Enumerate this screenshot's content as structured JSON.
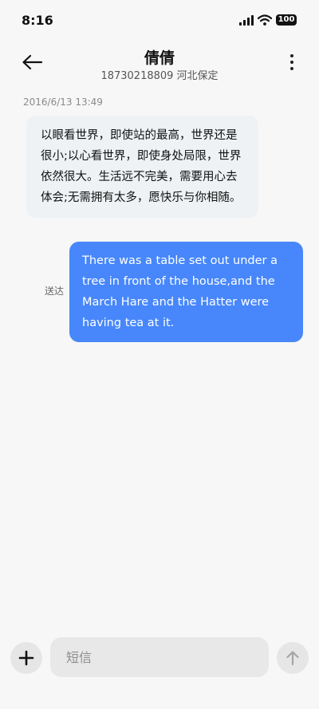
{
  "status_bar": {
    "time": "8:16",
    "battery": "100",
    "icons": [
      "signal-icon",
      "wifi-icon",
      "battery-icon"
    ]
  },
  "header": {
    "back_icon": "arrow-left-icon",
    "contact_name": "倩倩",
    "contact_subtitle": "18730218809 河北保定",
    "more_icon": "more-vertical-icon"
  },
  "conversation": {
    "timestamp": "2016/6/13 13:49",
    "messages": [
      {
        "direction": "incoming",
        "text": "以眼看世界，即使站的最高，世界还是很小;以心看世界，即使身处局限，世界依然很大。生活远不完美，需要用心去体会;无需拥有太多，愿快乐与你相随。"
      },
      {
        "direction": "outgoing",
        "text": "There was a table set out under a tree in front of the house,and the March Hare and the Hatter were having tea at it.",
        "status": "送达"
      }
    ]
  },
  "composer": {
    "add_icon": "plus-icon",
    "placeholder": "短信",
    "value": "",
    "send_icon": "arrow-up-icon"
  },
  "colors": {
    "background": "#f7f7f7",
    "incoming_bubble": "#eef2f5",
    "outgoing_bubble": "#4787fb",
    "input_background": "#e8e8e8"
  }
}
